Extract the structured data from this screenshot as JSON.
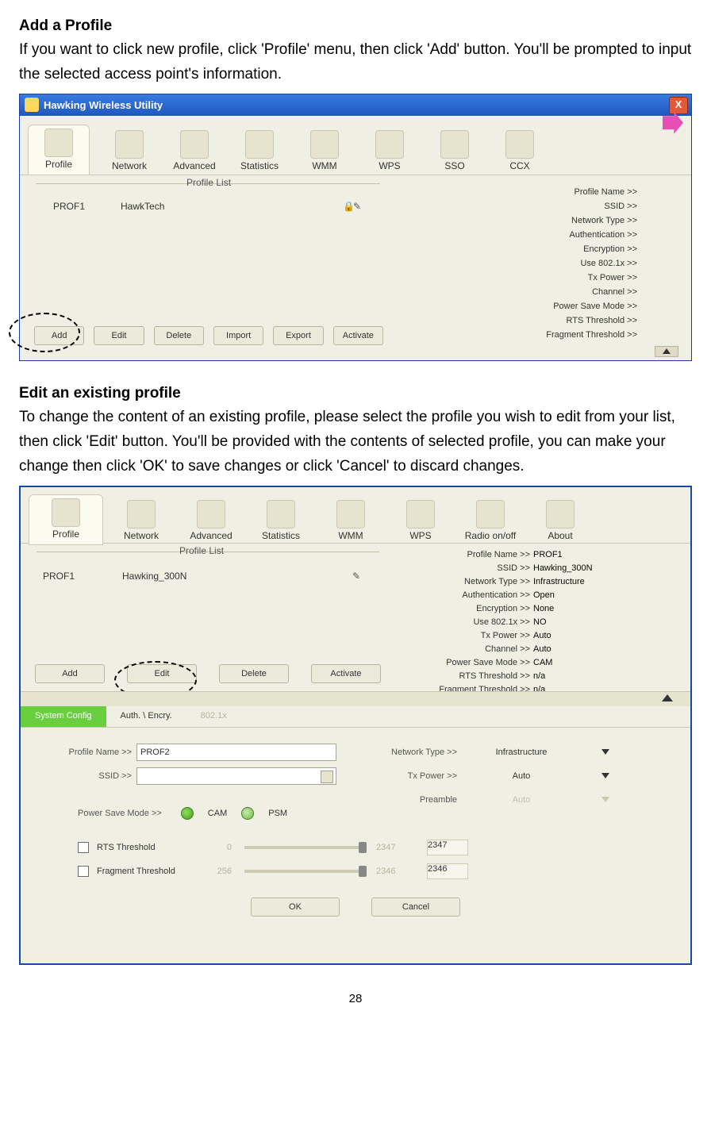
{
  "page_number": "28",
  "section1": {
    "heading": "Add a Profile",
    "para": "If you want to click new profile, click 'Profile' menu, then click 'Add' button. You'll be prompted to input the selected access point's information."
  },
  "section2": {
    "heading": "Edit an existing profile",
    "para": "To change the content of an existing profile, please select the profile you wish to edit from   your list, then click 'Edit' button. You'll be provided with the contents of selected profile, you can make your change then click 'OK' to save changes or click 'Cancel' to discard changes."
  },
  "ss1": {
    "window_title": "Hawking Wireless Utility",
    "tabs": [
      "Profile",
      "Network",
      "Advanced",
      "Statistics",
      "WMM",
      "WPS",
      "SSO",
      "CCX"
    ],
    "profile_list_title": "Profile List",
    "profile_row": {
      "name": "PROF1",
      "ssid": "HawkTech"
    },
    "buttons": [
      "Add",
      "Edit",
      "Delete",
      "Import",
      "Export",
      "Activate"
    ],
    "details_labels": [
      "Profile Name >>",
      "SSID >>",
      "Network Type >>",
      "Authentication >>",
      "Encryption >>",
      "Use 802.1x >>",
      "Tx Power >>",
      "Channel >>",
      "Power Save Mode >>",
      "RTS Threshold >>",
      "Fragment Threshold >>"
    ]
  },
  "ss2": {
    "tabs": [
      "Profile",
      "Network",
      "Advanced",
      "Statistics",
      "WMM",
      "WPS",
      "Radio on/off",
      "About"
    ],
    "profile_list_title": "Profile List",
    "profile_row": {
      "name": "PROF1",
      "ssid": "Hawking_300N"
    },
    "buttons": [
      "Add",
      "Edit",
      "Delete",
      "Activate"
    ],
    "details": [
      {
        "l": "Profile Name >>",
        "v": "PROF1"
      },
      {
        "l": "SSID >>",
        "v": "Hawking_300N"
      },
      {
        "l": "Network Type >>",
        "v": "Infrastructure"
      },
      {
        "l": "Authentication >>",
        "v": "Open"
      },
      {
        "l": "Encryption >>",
        "v": "None"
      },
      {
        "l": "Use 802.1x >>",
        "v": "NO"
      },
      {
        "l": "Tx Power >>",
        "v": "Auto"
      },
      {
        "l": "Channel >>",
        "v": "Auto"
      },
      {
        "l": "Power Save Mode >>",
        "v": "CAM"
      },
      {
        "l": "RTS Threshold >>",
        "v": "n/a"
      },
      {
        "l": "Fragment Threshold >>",
        "v": "n/a"
      }
    ],
    "cfg_tabs": {
      "active": "System Config",
      "t2": "Auth. \\ Encry.",
      "t3": "802.1x"
    },
    "form": {
      "profile_name_label": "Profile Name >>",
      "profile_name_value": "PROF2",
      "ssid_label": "SSID >>",
      "ssid_value": "",
      "network_type_label": "Network Type >>",
      "network_type_value": "Infrastructure",
      "tx_power_label": "Tx Power >>",
      "tx_power_value": "Auto",
      "preamble_label": "Preamble",
      "preamble_value": "Auto",
      "psm_label": "Power Save Mode >>",
      "psm_cam": "CAM",
      "psm_psm": "PSM",
      "rts_label": "RTS Threshold",
      "rts_min": "0",
      "rts_max": "2347",
      "rts_val": "2347",
      "frag_label": "Fragment Threshold",
      "frag_min": "256",
      "frag_max": "2346",
      "frag_val": "2346",
      "ok": "OK",
      "cancel": "Cancel"
    }
  }
}
